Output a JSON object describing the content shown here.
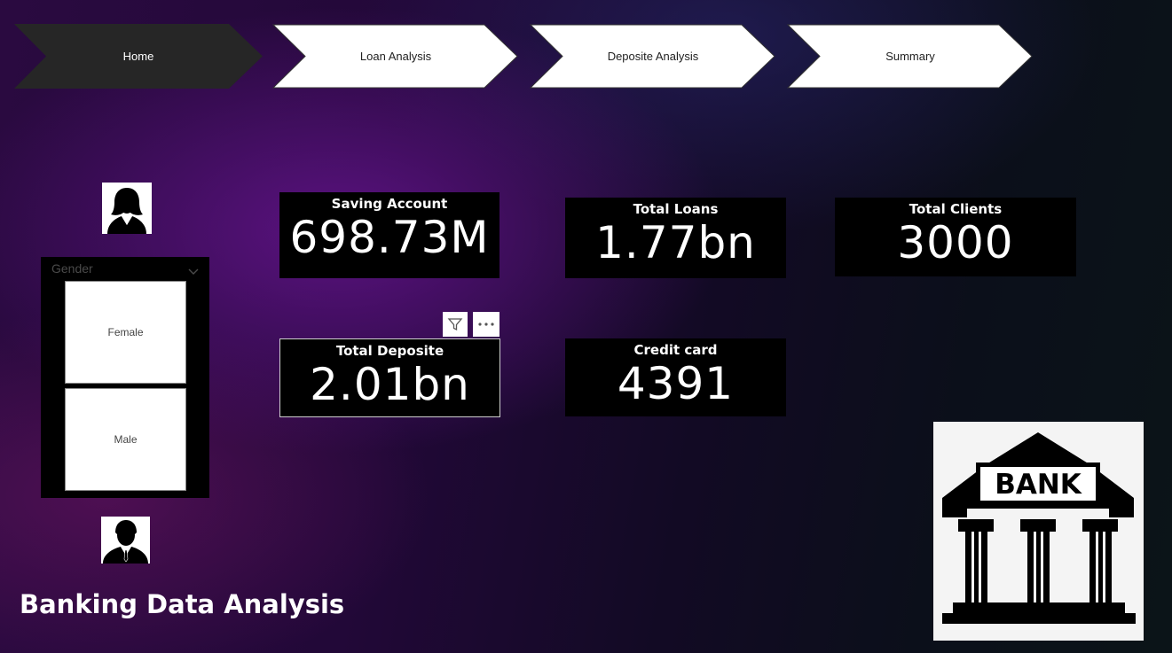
{
  "nav": {
    "tabs": [
      {
        "label": "Home",
        "active": true
      },
      {
        "label": "Loan Analysis",
        "active": false
      },
      {
        "label": "Deposite Analysis",
        "active": false
      },
      {
        "label": "Summary",
        "active": false
      }
    ]
  },
  "kpis": {
    "saving": {
      "label": "Saving Account",
      "value": "698.73M"
    },
    "loans": {
      "label": "Total Loans",
      "value": "1.77bn"
    },
    "clients": {
      "label": "Total Clients",
      "value": "3000"
    },
    "deposit": {
      "label": "Total Deposite",
      "value": "2.01bn"
    },
    "credit": {
      "label": "Credit card",
      "value": "4391"
    }
  },
  "slicer": {
    "header": "Gender",
    "options": [
      "Female",
      "Male"
    ]
  },
  "bank_logo_text": "BANK",
  "title": "Banking Data Analysis",
  "colors": {
    "active_tab": "#262626",
    "tab": "#ffffff",
    "card": "#000000"
  }
}
